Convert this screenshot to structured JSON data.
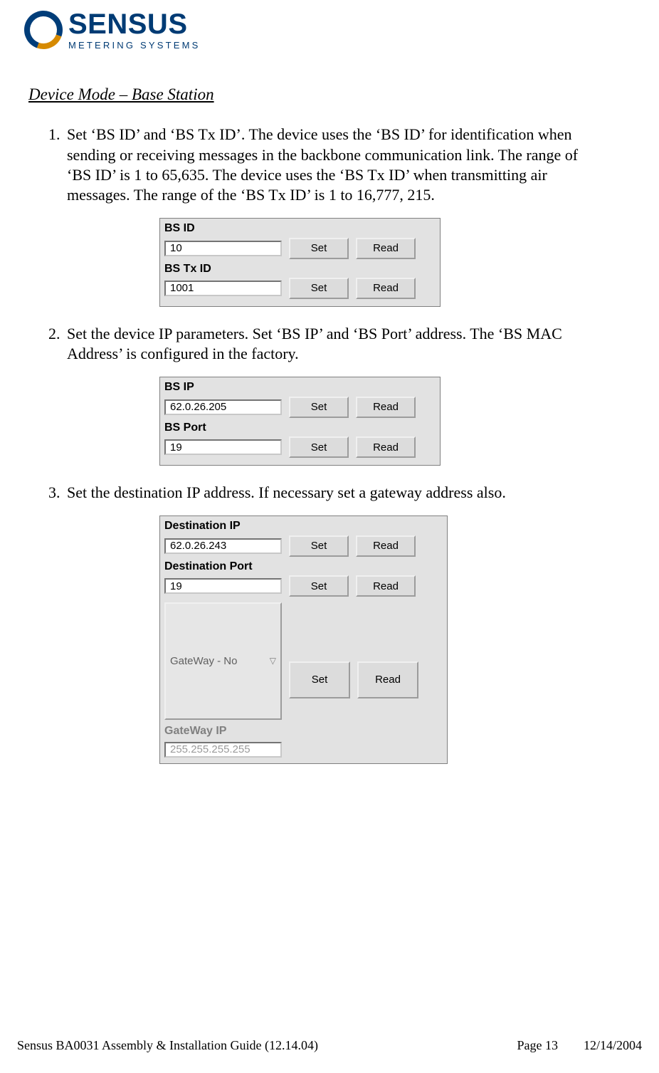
{
  "logo": {
    "brand": "SENSUS",
    "subtitle": "METERING SYSTEMS"
  },
  "section_title": "Device Mode – Base Station",
  "steps": [
    "Set ‘BS ID’ and ‘BS Tx ID’. The device uses the ‘BS ID’ for identification when sending or receiving messages in the backbone communication link. The range of ‘BS ID’ is 1 to 65,635. The device uses the ‘BS Tx ID’ when transmitting air messages. The range of the ‘BS Tx ID’ is 1 to 16,777, 215.",
    "Set the device IP parameters. Set ‘BS IP’ and ‘BS Port’ address. The ‘BS MAC Address’ is configured in the factory.",
    "Set the destination IP address. If necessary set a gateway address also."
  ],
  "panel1": {
    "label_bsid": "BS ID",
    "value_bsid": "10",
    "label_bstxid": "BS Tx ID",
    "value_bstxid": "1001",
    "set": "Set",
    "read": "Read"
  },
  "panel2": {
    "label_bsip": "BS IP",
    "value_bsip": "62.0.26.205",
    "label_bsport": "BS Port",
    "value_bsport": "19",
    "set": "Set",
    "read": "Read"
  },
  "panel3": {
    "label_destip": "Destination IP",
    "value_destip": "62.0.26.243",
    "label_destport": "Destination Port",
    "value_destport": "19",
    "gateway_select": "GateWay - No",
    "label_gatewayip": "GateWay IP",
    "value_gatewayip": "255.255.255.255",
    "set": "Set",
    "read": "Read"
  },
  "footer": {
    "left": "Sensus BA0031 Assembly & Installation Guide (12.14.04)",
    "page": "Page 13",
    "date": "12/14/2004"
  }
}
